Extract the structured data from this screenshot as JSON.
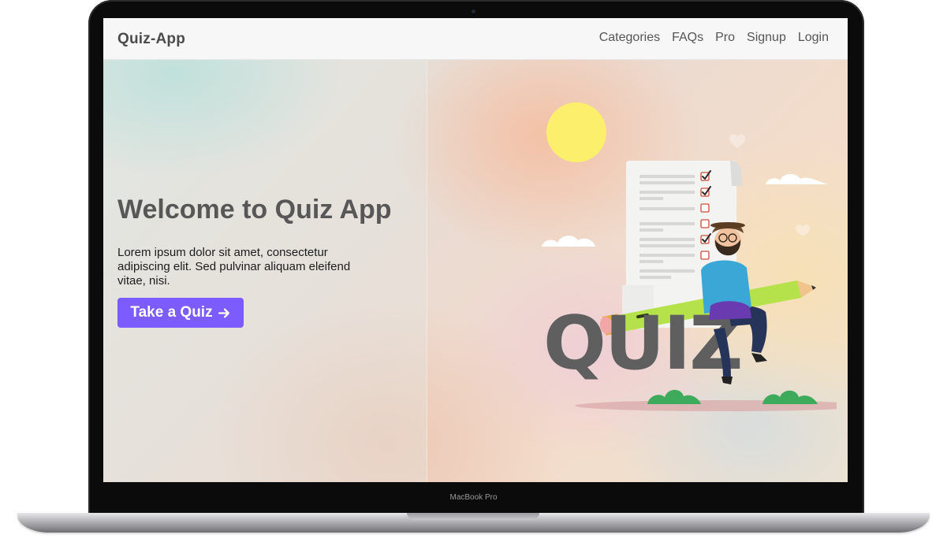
{
  "device": {
    "model_label": "MacBook Pro"
  },
  "navbar": {
    "brand": "Quiz-App",
    "links": [
      "Categories",
      "FAQs",
      "Pro",
      "Signup",
      "Login"
    ]
  },
  "hero": {
    "title": "Welcome to Quiz App",
    "text": "Lorem ipsum dolor sit amet, consectetur adipiscing elit. Sed pulvinar aliquam eleifend vitae, nisi.",
    "cta_label": "Take a Quiz",
    "cta_icon": "arrow-right-icon"
  },
  "illustration": {
    "word": "QUIZ",
    "checklist_checked": [
      true,
      true,
      false,
      false,
      true,
      false
    ]
  },
  "colors": {
    "accent": "#7c5cff",
    "brand_text": "#4b4b4b",
    "quiz_word": "#5f5f5f",
    "sun": "#fbef6c",
    "pencil": "#b5e24a",
    "shirt": "#3aa7d6",
    "bush": "#3eaa5b"
  }
}
